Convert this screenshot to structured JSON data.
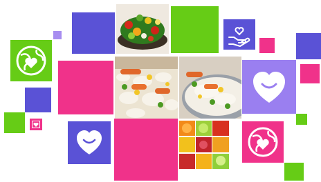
{
  "colors": {
    "purple": "#5a52d6",
    "green": "#66cc16",
    "magenta": "#f0328a",
    "lavender": "#a78df0",
    "light_purple": "#9a7ff0",
    "white": "#ffffff"
  },
  "tiles": {
    "salad_photo": "photo-salad",
    "rice_photo_left": "photo-vegetable-rice",
    "rice_photo_right": "photo-vegetable-rice-plate",
    "fruit_grid_photo": "photo-fruit-mosaic"
  },
  "icons": {
    "globe_heart": "globe-heart-icon",
    "smile_heart": "smile-heart-icon",
    "hand_heart": "hand-heart-icon",
    "small_heart": "heart-icon"
  }
}
